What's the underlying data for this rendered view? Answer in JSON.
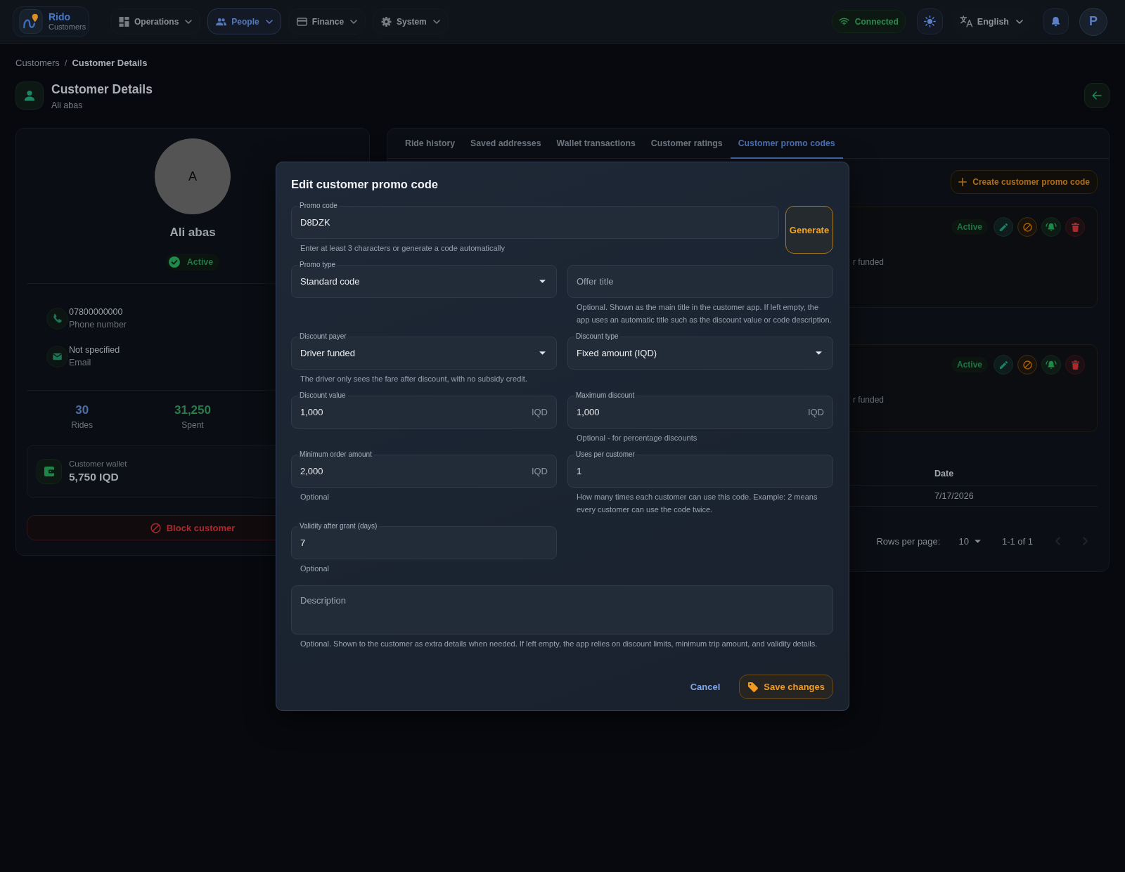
{
  "app": {
    "name": "Rido",
    "section": "Customers",
    "user_initial": "P"
  },
  "nav": [
    {
      "label": "Operations",
      "selected": false
    },
    {
      "label": "People",
      "selected": true
    },
    {
      "label": "Finance",
      "selected": false
    },
    {
      "label": "System",
      "selected": false
    }
  ],
  "toolbar": {
    "connection": "Connected",
    "language": "English"
  },
  "breadcrumbs": {
    "separator": "/",
    "items": [
      {
        "label": "Customers",
        "current": false
      },
      {
        "label": "Customer Details",
        "current": true
      }
    ]
  },
  "header": {
    "title": "Customer Details",
    "subtitle": "Ali abas"
  },
  "customer": {
    "initial": "A",
    "name": "Ali abas",
    "status": "Active",
    "contacts": [
      {
        "value": "07800000000",
        "label": "Phone number"
      },
      {
        "value": "Not specified",
        "label": "Email"
      }
    ],
    "stats": [
      {
        "value": "30",
        "label": "Rides",
        "color": "#4d6fa8"
      },
      {
        "value": "31,250",
        "label": "Spent",
        "color": "#2a7d4b"
      }
    ],
    "wallet": {
      "label": "Customer wallet",
      "balance": "5,750 IQD"
    },
    "block_button": "Block customer"
  },
  "panel": {
    "tabs": [
      {
        "label": "Ride history",
        "selected": false
      },
      {
        "label": "Saved addresses",
        "selected": false
      },
      {
        "label": "Wallet transactions",
        "selected": false
      },
      {
        "label": "Customer ratings",
        "selected": false
      },
      {
        "label": "Customer promo codes",
        "selected": true
      }
    ],
    "create_button": "Create customer promo code",
    "promo_codes": [
      {
        "status": "Active",
        "funding": "r funded"
      },
      {
        "status": "Active",
        "funding": "r funded"
      }
    ],
    "table": {
      "columns": [
        "Date"
      ],
      "rows": [
        [
          "7/17/2026"
        ]
      ]
    },
    "pagination": {
      "rows_per_page_label": "Rows per page:",
      "rows_per_page": "10",
      "range": "1-1 of 1",
      "previous": {
        "disabled": true
      },
      "next": {
        "disabled": true
      }
    }
  },
  "dialog": {
    "title": "Edit customer promo code",
    "promo_code": {
      "label": "Promo code",
      "value": "D8DZK",
      "helper": "Enter at least 3 characters or generate a code automatically"
    },
    "generate_button": "Generate",
    "fields": [
      {
        "kind": "select",
        "label": "Promo type",
        "value": "Standard code"
      },
      {
        "kind": "text",
        "placeholder": "Offer title",
        "helper": "Optional. Shown as the main title in the customer app. If left empty, the app uses an automatic title such as the discount value or code description."
      },
      {
        "kind": "select",
        "label": "Discount payer",
        "value": "Driver funded",
        "helper": "The driver only sees the fare after discount, with no subsidy credit."
      },
      {
        "kind": "select",
        "label": "Discount type",
        "value": "Fixed amount (IQD)"
      },
      {
        "kind": "text",
        "label": "Discount value",
        "value": "1,000",
        "unit": "IQD"
      },
      {
        "kind": "text",
        "label": "Maximum discount",
        "value": "1,000",
        "unit": "IQD",
        "helper": "Optional - for percentage discounts"
      },
      {
        "kind": "text",
        "label": "Minimum order amount",
        "value": "2,000",
        "unit": "IQD",
        "helper": "Optional"
      },
      {
        "kind": "text",
        "label": "Uses per customer",
        "value": "1",
        "helper": "How many times each customer can use this code. Example: 2 means every customer can use the code twice."
      },
      {
        "kind": "text",
        "label": "Validity after grant (days)",
        "value": "7",
        "helper": "Optional"
      }
    ],
    "description": {
      "placeholder": "Description",
      "helper": "Optional. Shown to the customer as extra details when needed. If left empty, the app relies on discount limits, minimum trip amount, and validity details."
    },
    "cancel_button": "Cancel",
    "save_button": "Save changes"
  }
}
